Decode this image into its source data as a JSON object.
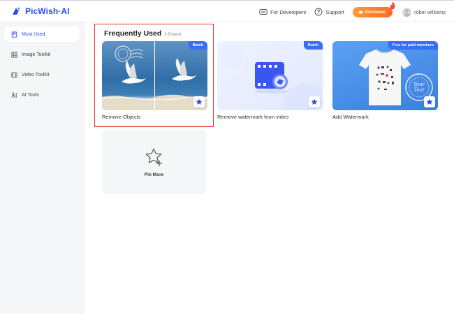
{
  "app": {
    "logo_text": "PicWish·AI"
  },
  "topbar": {
    "developers_label": "For Developers",
    "support_label": "Support",
    "purchase_label": "Purchase",
    "username": "robin williams"
  },
  "sidebar": {
    "items": [
      {
        "label": "Most Used",
        "icon": "bookmark-icon",
        "active": true
      },
      {
        "label": "Image Toolkit",
        "icon": "grid-icon",
        "active": false
      },
      {
        "label": "Video Toolkit",
        "icon": "film-icon",
        "active": false
      },
      {
        "label": "AI Tools",
        "icon": "ai-icon",
        "active": false
      }
    ]
  },
  "main": {
    "section_title": "Frequently Used",
    "pinned_count": "3 Pinned",
    "cards": [
      {
        "label": "Remove Objects",
        "tag": "Batch"
      },
      {
        "label": "Remove watermark from video",
        "tag": "Batch"
      },
      {
        "label": "Add Watermark",
        "tag": "Free for paid members"
      }
    ],
    "pin_more_label": "Pin More"
  },
  "colors": {
    "accent": "#2b4cf1",
    "highlight": "#e8322f",
    "purchase": "#ff7a2a",
    "sidebar_bg": "#f5f6f8"
  }
}
